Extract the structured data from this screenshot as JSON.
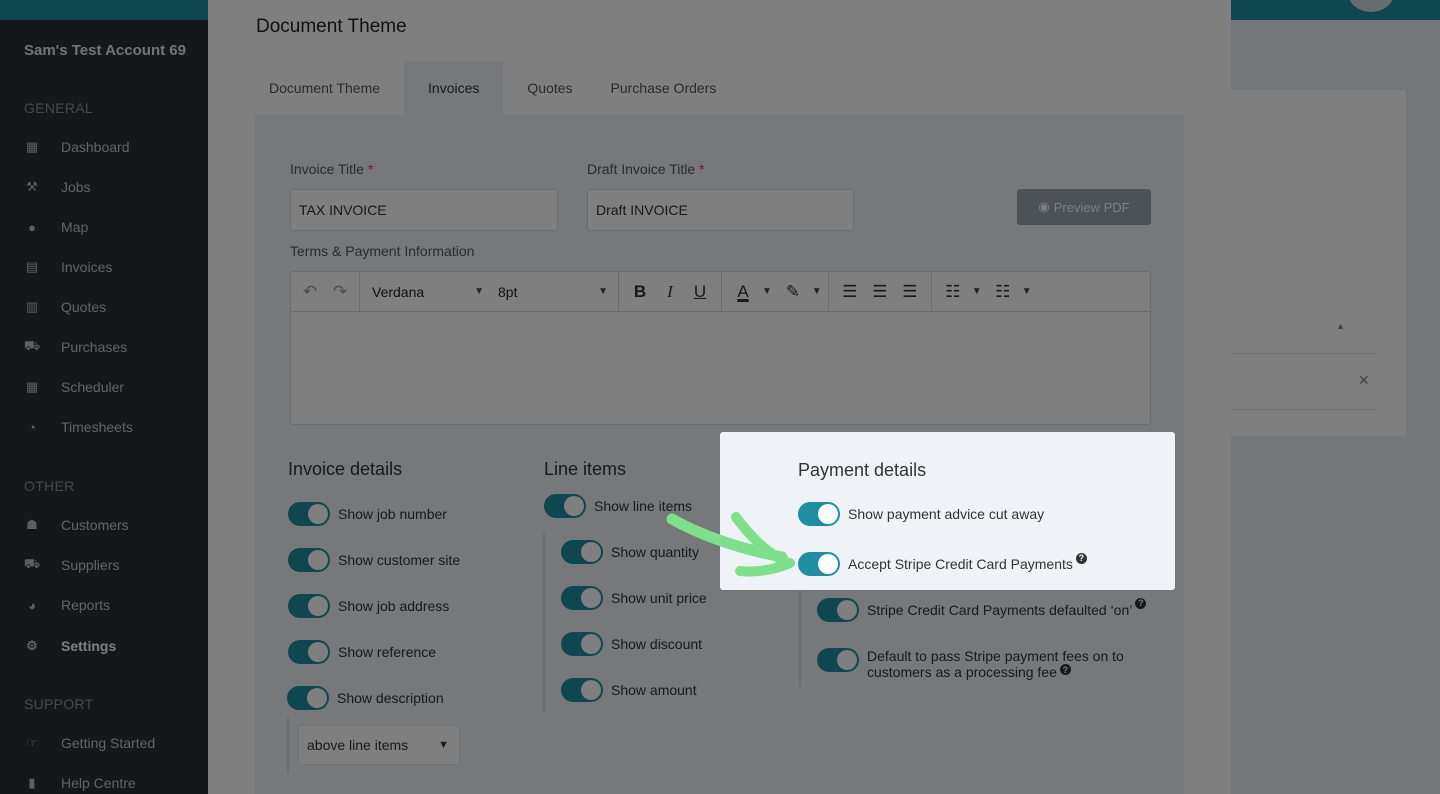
{
  "sidebar": {
    "account_name": "Sam's Test Account 69",
    "general_heading": "GENERAL",
    "other_heading": "OTHER",
    "support_heading": "SUPPORT",
    "general": [
      {
        "label": "Dashboard",
        "icon": "dashboard-icon"
      },
      {
        "label": "Jobs",
        "icon": "hammer-icon"
      },
      {
        "label": "Map",
        "icon": "map-pin-icon"
      },
      {
        "label": "Invoices",
        "icon": "document-icon"
      },
      {
        "label": "Quotes",
        "icon": "calculator-icon"
      },
      {
        "label": "Purchases",
        "icon": "cart-icon"
      },
      {
        "label": "Scheduler",
        "icon": "calendar-icon"
      },
      {
        "label": "Timesheets",
        "icon": "clock-icon"
      }
    ],
    "other": [
      {
        "label": "Customers",
        "icon": "users-icon"
      },
      {
        "label": "Suppliers",
        "icon": "truck-icon"
      },
      {
        "label": "Reports",
        "icon": "pie-chart-icon"
      },
      {
        "label": "Settings",
        "icon": "gear-icon",
        "active": true
      }
    ],
    "support": [
      {
        "label": "Getting Started",
        "icon": "hand-point-icon"
      },
      {
        "label": "Help Centre",
        "icon": "book-icon"
      }
    ]
  },
  "modal": {
    "title": "Document Theme",
    "tabs": [
      {
        "label": "Document Theme"
      },
      {
        "label": "Invoices",
        "active": true
      },
      {
        "label": "Quotes"
      },
      {
        "label": "Purchase Orders"
      }
    ],
    "invoice_title_label": "Invoice Title",
    "invoice_title_value": "TAX INVOICE",
    "draft_title_label": "Draft Invoice Title",
    "draft_title_value": "Draft INVOICE",
    "required_mark": "*",
    "preview_button": "Preview PDF",
    "terms_label": "Terms & Payment Information",
    "editor": {
      "font_family": "Verdana",
      "font_size": "8pt"
    },
    "invoice_details": {
      "title": "Invoice details",
      "toggles": [
        "Show job number",
        "Show customer site",
        "Show job address",
        "Show reference",
        "Show description"
      ],
      "description_position": "above line items"
    },
    "line_items": {
      "title": "Line items",
      "main_toggle": "Show line items",
      "toggles": [
        "Show quantity",
        "Show unit price",
        "Show discount",
        "Show amount"
      ]
    },
    "payment_details": {
      "title": "Payment details",
      "toggles": [
        "Show payment advice cut away",
        "Accept Stripe Credit Card Payments"
      ],
      "sub_toggles": [
        "Stripe Credit Card Payments defaulted ‘on’"
      ],
      "pass_fees_line1": "Default to pass Stripe payment fees on to",
      "pass_fees_line2": "customers as a processing fee"
    }
  },
  "colors": {
    "accent": "#1e8fa3",
    "highlight_arrow": "#7ee08a",
    "sidebar_bg": "#2b3037"
  }
}
